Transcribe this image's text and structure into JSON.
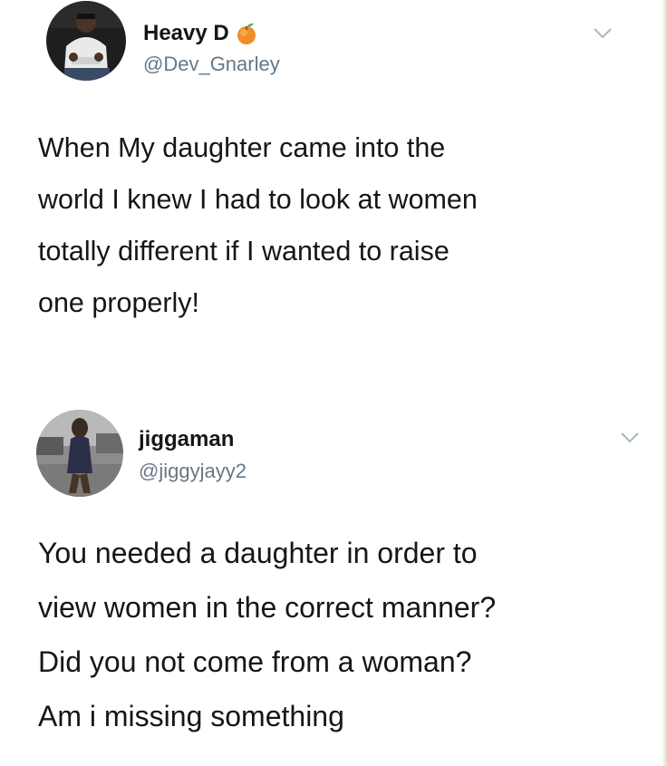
{
  "tweets": [
    {
      "display_name": "Heavy D",
      "badge_icon": "peach-emoji-icon",
      "handle": "@Dev_Gnarley",
      "text_lines": [
        "When My daughter came into the",
        "world I knew I had to look at women",
        "totally different if I wanted to raise",
        "one properly!"
      ]
    },
    {
      "display_name": "jiggaman",
      "handle": "@jiggyjayy2",
      "text_lines": [
        "You needed a daughter in order to",
        "view women in the correct manner?",
        "Did you not come from a woman?",
        "Am i missing something"
      ]
    }
  ],
  "colors": {
    "text": "#14171a",
    "secondary": "#657786",
    "background": "#ffffff",
    "chevron": "#aab8c2"
  }
}
